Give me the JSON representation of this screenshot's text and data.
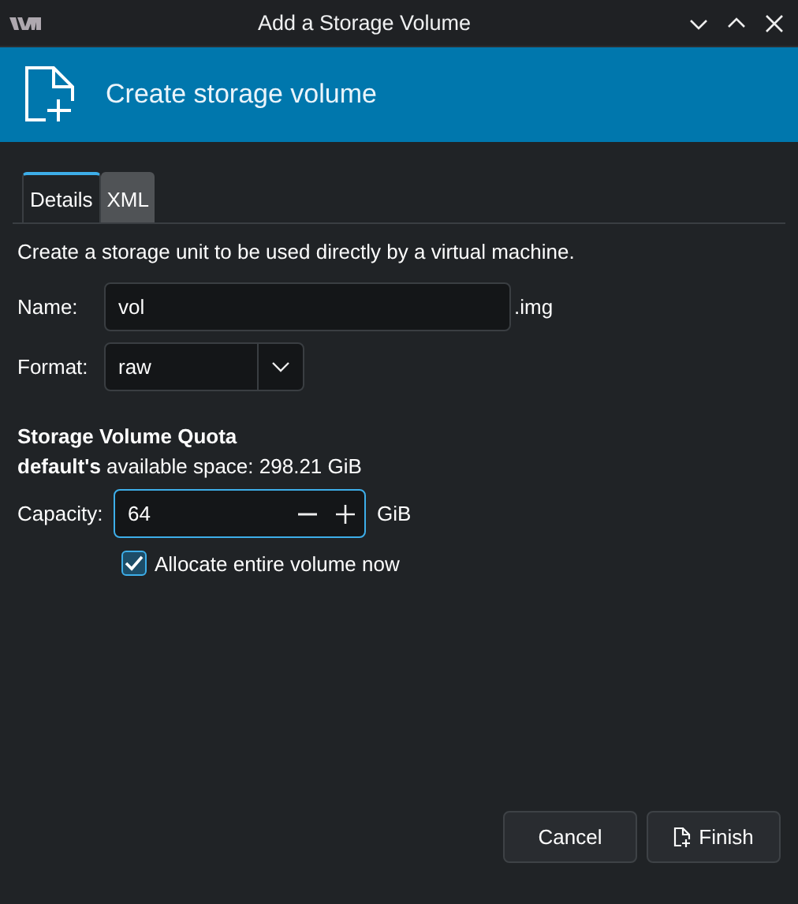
{
  "window": {
    "title": "Add a Storage Volume"
  },
  "banner": {
    "title": "Create storage volume"
  },
  "tabs": [
    {
      "label": "Details",
      "selected": true
    },
    {
      "label": "XML",
      "selected": false
    }
  ],
  "description": "Create a storage unit to be used directly by a virtual machine.",
  "name_field": {
    "label": "Name:",
    "value": "vol",
    "suffix": ".img"
  },
  "format": {
    "label": "Format:",
    "value": "raw"
  },
  "quota": {
    "heading": "Storage Volume Quota",
    "available": "**default's** available space: 298.21 GiB"
  },
  "capacity": {
    "label": "Capacity:",
    "value": "64",
    "focused": true,
    "unit": "GiB"
  },
  "allocate": {
    "label": "Allocate entire volume now",
    "checked": true
  },
  "buttons": [
    {
      "label": "Cancel",
      "kind": "plain"
    },
    {
      "label": "Finish",
      "kind": "finish"
    }
  ]
}
